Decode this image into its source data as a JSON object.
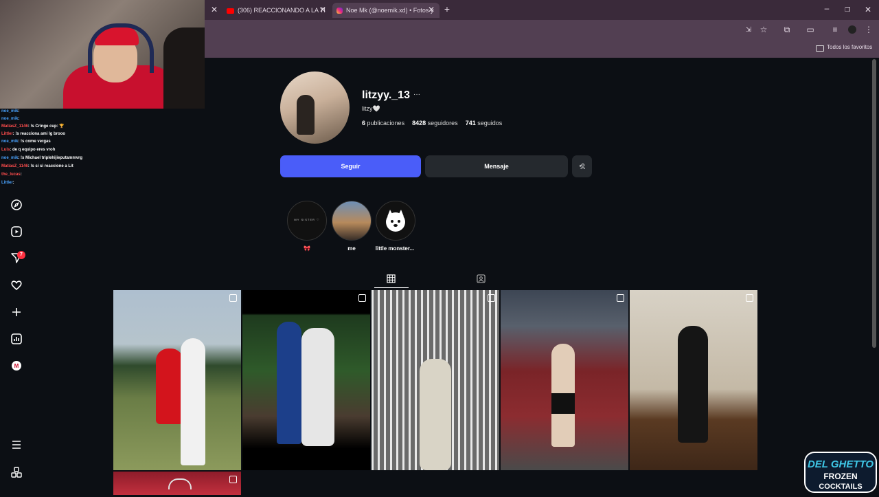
{
  "browser": {
    "tabs": [
      {
        "label": "(306) REACCIONANDO A LA TI"
      },
      {
        "label": "Noe Mk (@noemik.xd) • Fotos y"
      }
    ],
    "new_tab": "+",
    "bookmarks_label": "Todos los favoritos"
  },
  "chat": {
    "lines": [
      {
        "user": "noe_mik",
        "message": ":"
      },
      {
        "user": "noe_mik",
        "message": ":"
      },
      {
        "user": "MatiasZ_1146",
        "message": ": !s Cringe cup: 🏆"
      },
      {
        "user": "Littler",
        "message": ": !s reacciona ami lg brooo"
      },
      {
        "user": "noe_mik",
        "message": ": !s come vergas"
      },
      {
        "user": "Luis",
        "message": ": de q equipo eres vroh"
      },
      {
        "user": "noe_mik",
        "message": ": !s Michael triplehijieputammvrg"
      },
      {
        "user": "MatiasZ_1146",
        "message": ": !s si si reaccione a Lit"
      },
      {
        "user": "the_lucas",
        "message": ":"
      },
      {
        "user": "Littler",
        "message": ":"
      }
    ]
  },
  "sidebar": {
    "notification_count": "7"
  },
  "profile": {
    "username": "litzyy._13",
    "more": "···",
    "bio": "litzy🤍",
    "stats": {
      "posts_num": "6",
      "posts_label": "publicaciones",
      "followers_num": "8428",
      "followers_label": "seguidores",
      "following_num": "741",
      "following_label": "seguidos"
    },
    "follow_label": "Seguir",
    "message_label": "Mensaje",
    "highlights": [
      {
        "label": "🎀",
        "cover_text": "MY SISTER ♡"
      },
      {
        "label": "me"
      },
      {
        "label": "little monster..."
      }
    ]
  },
  "colors": {
    "follow_button": "#4a5df9",
    "background": "#0c0f14",
    "tab_bar": "#3a2a3a"
  },
  "watermark": "DEL GHETTO FROZEN COCKTAILS"
}
